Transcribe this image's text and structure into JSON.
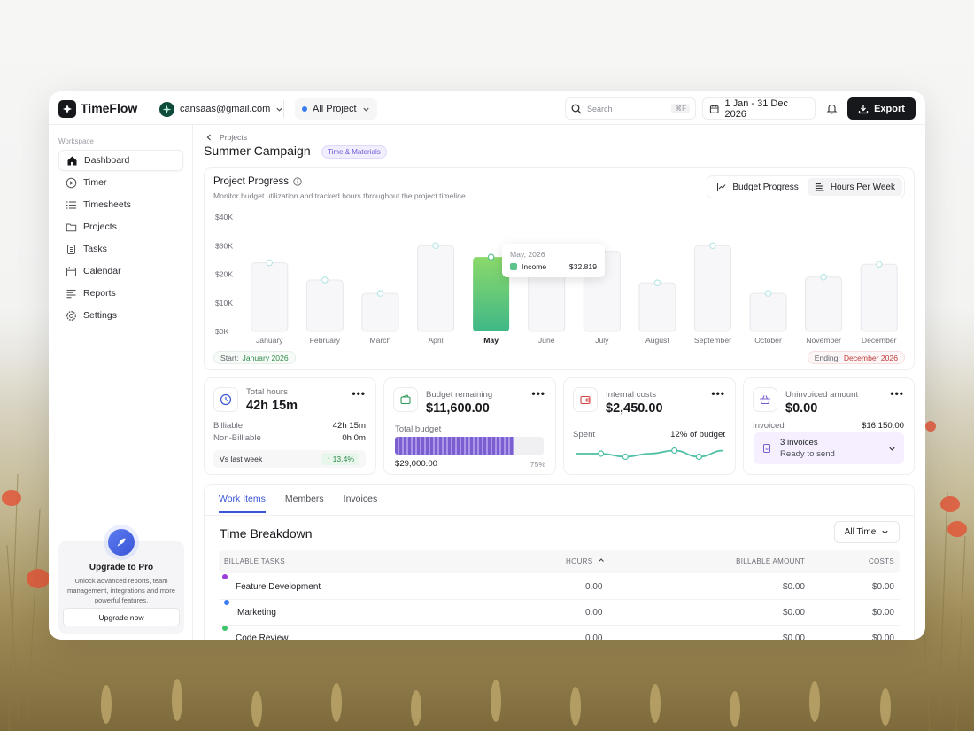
{
  "app": {
    "name": "TimeFlow"
  },
  "topbar": {
    "account_email": "cansaas@gmail.com",
    "project_filter": "All Project",
    "search_placeholder": "Search",
    "search_shortcut": "⌘F",
    "date_range": "1 Jan - 31 Dec 2026",
    "export_label": "Export"
  },
  "sidebar": {
    "section_label": "Workspace",
    "items": [
      {
        "label": "Dashboard",
        "icon": "home-icon",
        "active": true
      },
      {
        "label": "Timer",
        "icon": "play-icon"
      },
      {
        "label": "Timesheets",
        "icon": "list-icon"
      },
      {
        "label": "Projects",
        "icon": "folder-icon"
      },
      {
        "label": "Tasks",
        "icon": "task-icon"
      },
      {
        "label": "Calendar",
        "icon": "calendar-icon"
      },
      {
        "label": "Reports",
        "icon": "report-icon"
      },
      {
        "label": "Settings",
        "icon": "gear-icon"
      }
    ],
    "promo": {
      "title": "Upgrade to Pro",
      "description": "Unlock advanced reports, team management, integrations and more powerful features.",
      "button": "Upgrade now"
    }
  },
  "page": {
    "breadcrumb": "Projects",
    "title": "Summer Campaign",
    "tag": "Time & Materials"
  },
  "progress": {
    "title": "Project Progress",
    "subtitle": "Monitor budget utilization and tracked hours throughout the project timeline.",
    "toggle": [
      "Budget Progress",
      "Hours Per Week"
    ],
    "start_label": "Start:",
    "start_value": "January 2026",
    "end_label": "Ending:",
    "end_value": "December 2026",
    "tooltip": {
      "title": "May, 2026",
      "label": "Income",
      "value": "$32.819"
    }
  },
  "chart_data": {
    "type": "bar",
    "categories": [
      "January",
      "February",
      "March",
      "April",
      "May",
      "June",
      "July",
      "August",
      "September",
      "October",
      "November",
      "December"
    ],
    "values": [
      24000,
      18000,
      13300,
      30000,
      26000,
      25000,
      28000,
      17000,
      30000,
      13300,
      19000,
      23500
    ],
    "highlighted": "May",
    "ylim": [
      0,
      40000
    ],
    "yticks": [
      "$0K",
      "$10K",
      "$20K",
      "$30K",
      "$40K"
    ],
    "colors": {
      "bar": "#f7f7f9",
      "bar_border": "#e8e8ec",
      "highlight": "#5cc48a"
    }
  },
  "stats": {
    "total_hours": {
      "label": "Total hours",
      "value": "42h 15m",
      "billable_label": "Billiable",
      "billable_value": "42h 15m",
      "nonbillable_label": "Non-Billiable",
      "nonbillable_value": "0h 0m",
      "vs_label": "Vs last week",
      "vs_value": "13.4%"
    },
    "budget": {
      "label": "Budget remaining",
      "value": "$11,600.00",
      "total_label": "Total budget",
      "total_value": "$29,000.00",
      "percent": "75%",
      "fill": 0.8
    },
    "costs": {
      "label": "Internal costs",
      "value": "$2,450.00",
      "spent_label": "Spent",
      "spent_value": "12% of budget",
      "sparkline": [
        4,
        4,
        3,
        4,
        5,
        3,
        5
      ]
    },
    "uninvoiced": {
      "label": "Uninvoiced amount",
      "value": "$0.00",
      "invoiced_label": "Invoiced",
      "invoiced_value": "$16,150.00",
      "invoices_title": "3 invoices",
      "invoices_sub": "Ready to send"
    }
  },
  "work": {
    "tabs": [
      "Work Items",
      "Members",
      "Invoices"
    ],
    "title": "Time Breakdown",
    "filter": "All Time",
    "headers": [
      "BILLABLE TASKS",
      "HOURS",
      "BILLABLE AMOUNT",
      "COSTS"
    ],
    "rows": [
      {
        "task": "Feature Development",
        "color": "#9b3fd9",
        "hours": "0.00",
        "amount": "$0.00",
        "cost": "$0.00"
      },
      {
        "task": "Marketing",
        "color": "#3a7bf0",
        "hours": "0.00",
        "amount": "$0.00",
        "cost": "$0.00"
      },
      {
        "task": "Code Review",
        "color": "#3fc46c",
        "hours": "0.00",
        "amount": "$0.00",
        "cost": "$0.00"
      }
    ]
  }
}
